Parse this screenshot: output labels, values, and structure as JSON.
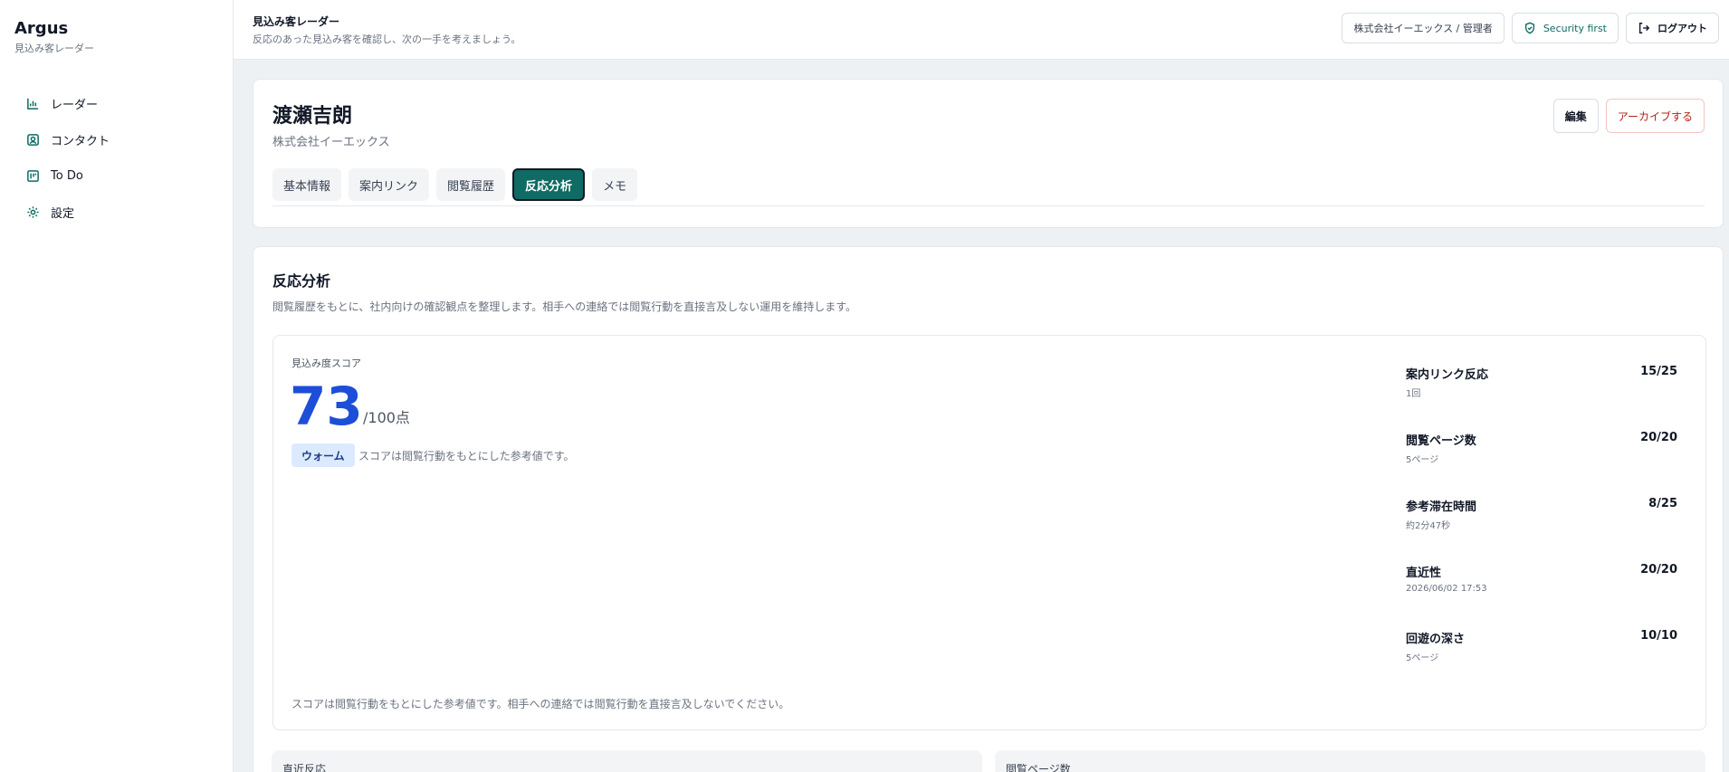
{
  "brand": {
    "title": "Argus",
    "subtitle": "見込み客レーダー"
  },
  "sidebar": {
    "items": [
      {
        "label": "レーダー",
        "icon": "bar-chart-icon"
      },
      {
        "label": "コンタクト",
        "icon": "contact-icon"
      },
      {
        "label": "To Do",
        "icon": "todo-icon"
      },
      {
        "label": "設定",
        "icon": "gear-icon"
      }
    ]
  },
  "header": {
    "title": "見込み客レーダー",
    "subtitle": "反応のあった見込み客を確認し、次の一手を考えましょう。",
    "org_label": "株式会社イーエックス / 管理者",
    "security_label": "Security first",
    "logout_label": "ログアウト"
  },
  "profile": {
    "name": "渡瀬吉朗",
    "company": "株式会社イーエックス",
    "edit_label": "編集",
    "archive_label": "アーカイブする",
    "tabs": [
      {
        "label": "基本情報",
        "active": false
      },
      {
        "label": "案内リンク",
        "active": false
      },
      {
        "label": "閲覧履歴",
        "active": false
      },
      {
        "label": "反応分析",
        "active": true
      },
      {
        "label": "メモ",
        "active": false
      }
    ]
  },
  "analysis": {
    "title": "反応分析",
    "description": "閲覧履歴をもとに、社内向けの確認観点を整理します。相手への連絡では閲覧行動を直接言及しない運用を維持します。",
    "score_label": "見込み度スコア",
    "score_value": "73",
    "score_max": "/100点",
    "badge": "ウォーム",
    "badge_note": "スコアは閲覧行動をもとにした参考値です。",
    "footer_note": "スコアは閲覧行動をもとにした参考値です。相手への連絡では閲覧行動を直接言及しないでください。",
    "metrics": [
      {
        "name": "案内リンク反応",
        "score": "15/25",
        "detail": "1回"
      },
      {
        "name": "閲覧ページ数",
        "score": "20/20",
        "detail": "5ページ"
      },
      {
        "name": "参考滞在時間",
        "score": "8/25",
        "detail": "約2分47秒"
      },
      {
        "name": "直近性",
        "score": "20/20",
        "detail": "2026/06/02 17:53"
      },
      {
        "name": "回遊の深さ",
        "score": "10/10",
        "detail": "5ページ"
      }
    ],
    "bottom_left_label": "直近反応",
    "bottom_right_label": "閲覧ページ数"
  },
  "colors": {
    "accent": "#0f6b63",
    "score": "#1d4ed8",
    "danger": "#b42318",
    "badge_bg": "#dbeafe"
  }
}
